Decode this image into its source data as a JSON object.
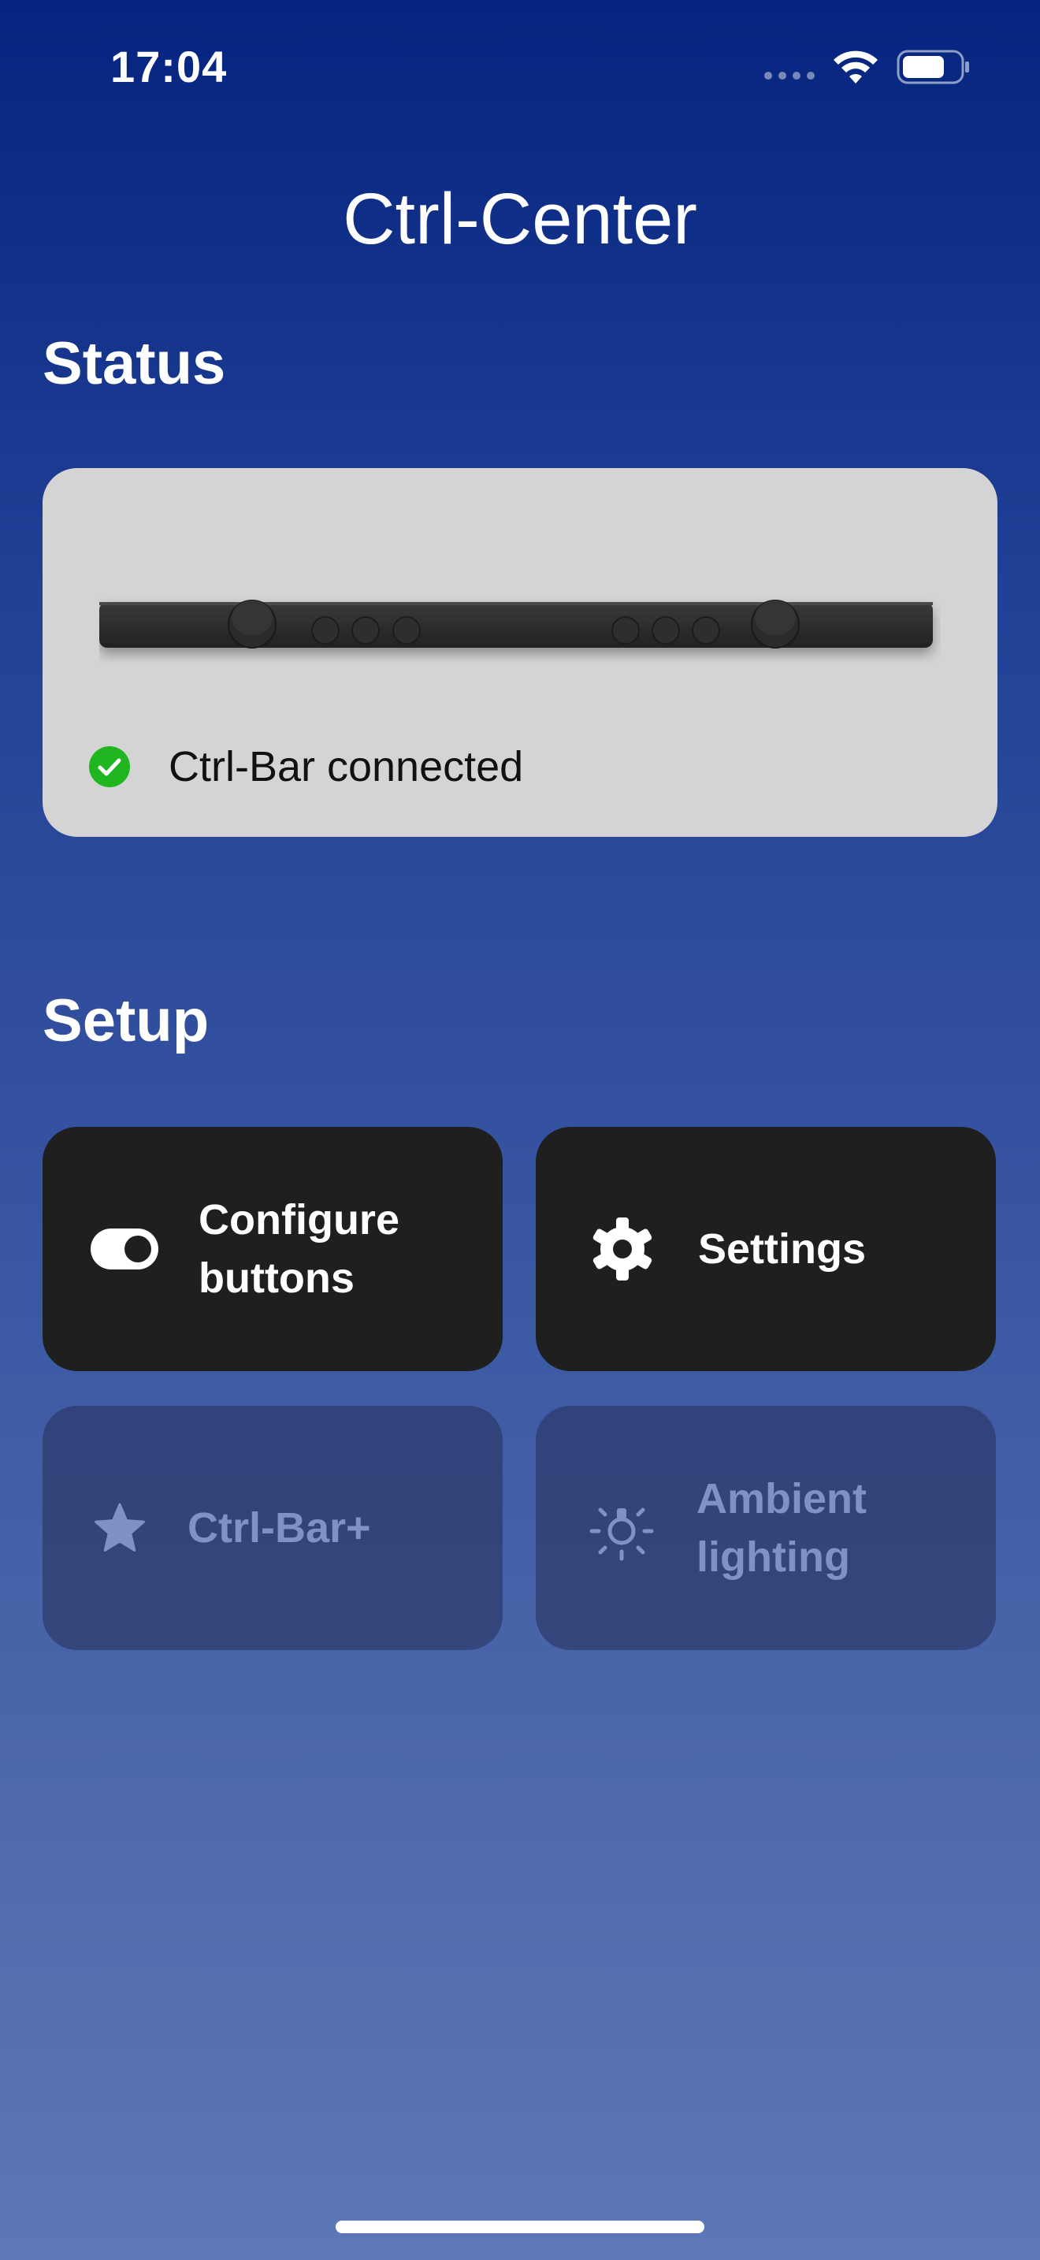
{
  "status_bar": {
    "time": "17:04",
    "icons": [
      "cellular-signal-icon",
      "wifi-icon",
      "battery-icon"
    ]
  },
  "header": {
    "title": "Ctrl-Center"
  },
  "status_section": {
    "title": "Status",
    "device": "Ctrl-Bar",
    "connection_text": "Ctrl-Bar connected",
    "connection_icon": "checkmark-circle-icon"
  },
  "setup_section": {
    "title": "Setup",
    "tiles": [
      {
        "label_line1": "Configure",
        "label_line2": "buttons",
        "icon": "toggle-icon",
        "enabled": true
      },
      {
        "label_line1": "Settings",
        "icon": "gear-icon",
        "enabled": true
      },
      {
        "label_line1": "Ctrl-Bar+",
        "icon": "star-icon",
        "enabled": false
      },
      {
        "label_line1": "Ambient",
        "label_line2": "lighting",
        "icon": "lightbulb-icon",
        "enabled": false
      }
    ]
  },
  "colors": {
    "gradient_top": "#04247f",
    "gradient_bottom": "#5c78b6",
    "card_background": "#d4d4d4",
    "tile_active": "#1f1f1f",
    "tile_disabled_text": "#7f92c7",
    "connected_green": "#1fb61f"
  }
}
